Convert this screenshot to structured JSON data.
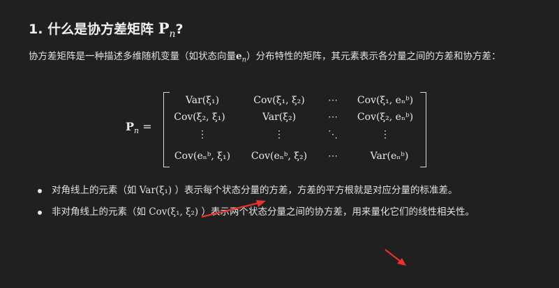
{
  "heading": {
    "number": "1.",
    "text_before": "什么是协方差矩阵",
    "symbol": "P",
    "subscript": "n",
    "text_after": "?"
  },
  "intro": {
    "text_before": "协方差矩阵是一种描述多维随机变量（如状态向量",
    "symbol": "e",
    "subscript": "n",
    "text_after": "）分布特性的矩阵，其元素表示各分量之间的方差和协方差："
  },
  "equation": {
    "lhs_symbol": "P",
    "lhs_subscript": "n",
    "equals": "=",
    "rows": [
      [
        "Var(ξ₁)",
        "Cov(ξ₁, ξ₂)",
        "⋯",
        "Cov(ξ₁, eₙᵇ)"
      ],
      [
        "Cov(ξ₂, ξ₁)",
        "Var(ξ₂)",
        "⋯",
        "Cov(ξ₂, eₙᵇ)"
      ],
      [
        "⋮",
        "⋮",
        "⋱",
        "⋮"
      ],
      [
        "Cov(eₙᵇ, ξ₁)",
        "Cov(eₙᵇ, ξ₂)",
        "⋯",
        "Var(eₙᵇ)"
      ]
    ]
  },
  "bullets": [
    {
      "text_before": "对角线上的元素（如",
      "math": "Var(ξ₁)",
      "text_after": "）表示每个状态分量的方差，方差的平方根就是对应分量的标准差。"
    },
    {
      "text_before": "非对角线上的元素（如",
      "math": "Cov(ξ₁, ξ₂)",
      "text_after": "）表示两个状态分量之间的协方差，用来量化它们的线性相关性。"
    }
  ],
  "colors": {
    "background": "#202020",
    "text": "#e2e2e2",
    "annotation_arrow": "#e8322b"
  }
}
